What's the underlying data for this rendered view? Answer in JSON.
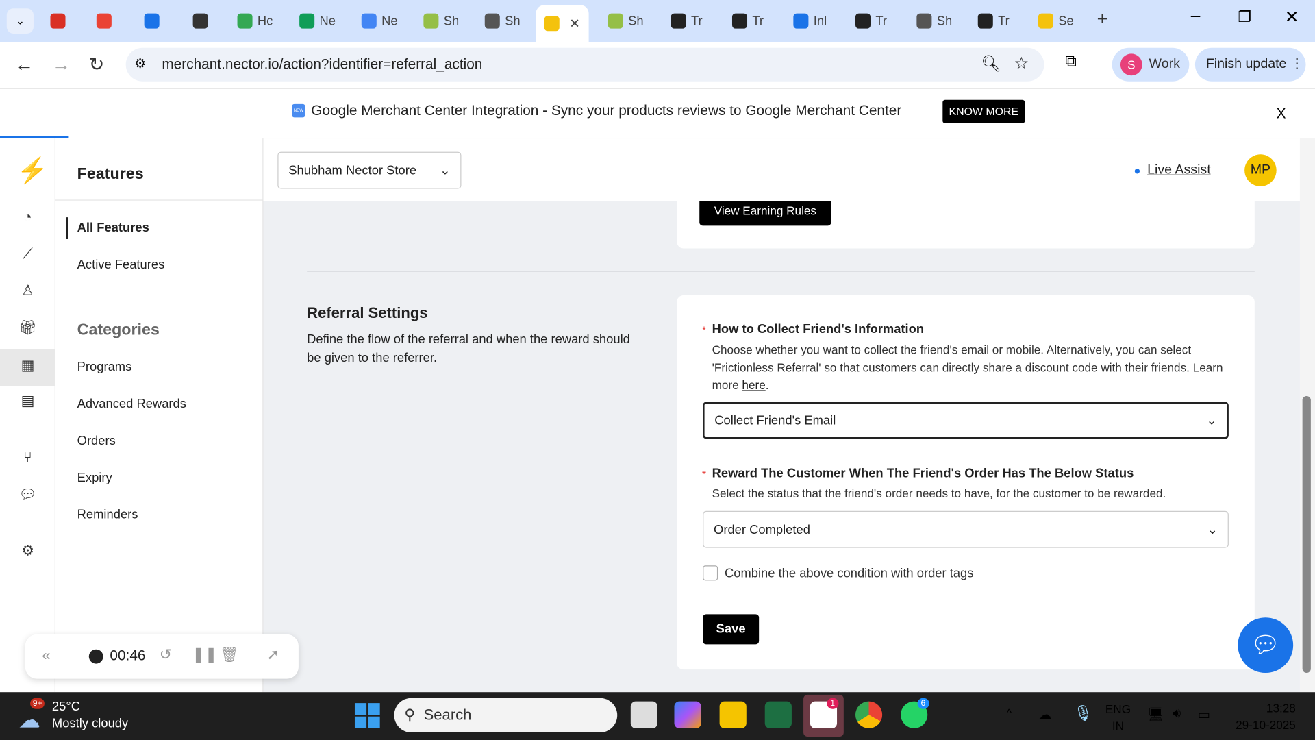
{
  "browser": {
    "tabs": [
      {
        "label": "",
        "color": "#d93025"
      },
      {
        "label": "",
        "color": "#ea4335"
      },
      {
        "label": "",
        "color": "#1a73e8"
      },
      {
        "label": "",
        "color": "#333"
      },
      {
        "label": "Hc",
        "color": "#34a853"
      },
      {
        "label": "Ne",
        "color": "#0f9d58"
      },
      {
        "label": "Ne",
        "color": "#4285f4"
      },
      {
        "label": "Sh",
        "color": "#95bf47"
      },
      {
        "label": "Sh",
        "color": "#555"
      },
      {
        "label": "",
        "color": "#f4c20d"
      },
      {
        "label": "Sh",
        "color": "#95bf47"
      },
      {
        "label": "Tr",
        "color": "#222"
      },
      {
        "label": "Tr",
        "color": "#222"
      },
      {
        "label": "Inl",
        "color": "#1a73e8"
      },
      {
        "label": "Tr",
        "color": "#222"
      },
      {
        "label": "Sh",
        "color": "#555"
      },
      {
        "label": "Tr",
        "color": "#222"
      },
      {
        "label": "Se",
        "color": "#f4c20d"
      }
    ],
    "url": "merchant.nector.io/action?identifier=referral_action",
    "profile_initial": "S",
    "profile_label": "Work",
    "update_label": "Finish update"
  },
  "banner": {
    "badge": "NEW",
    "text": "Google Merchant Center Integration - Sync your products reviews to Google Merchant Center",
    "button": "KNOW MORE",
    "close": "X"
  },
  "app": {
    "features_title": "Features",
    "nav": [
      "All Features",
      "Active Features"
    ],
    "categories_title": "Categories",
    "categories": [
      "Programs",
      "Advanced Rewards",
      "Orders",
      "Expiry",
      "Reminders"
    ],
    "store": "Shubham Nector Store",
    "live_assist": "Live Assist",
    "avatar": "MP",
    "view_rules": "View Earning Rules",
    "section_title": "Referral Settings",
    "section_desc": "Define the flow of the referral and when the reward should be given to the referrer.",
    "q1_title": "How to Collect Friend's Information",
    "q1_desc": "Choose whether you want to collect the friend's email or mobile. Alternatively, you can select 'Frictionless Referral' so that customers can directly share a discount code with their friends.",
    "q1_learn": "Learn more ",
    "q1_link": "here",
    "q1_value": "Collect Friend's Email",
    "q2_title": "Reward The Customer When The Friend's Order Has The Below Status",
    "q2_desc": "Select the status that the friend's order needs to have, for the customer to be rewarded.",
    "q2_value": "Order Completed",
    "checkbox_label": "Combine the above condition with order tags",
    "checkbox_checked": false,
    "save": "Save",
    "required_mark": "*"
  },
  "recorder": {
    "time": "00:46"
  },
  "taskbar": {
    "weather_badge": "9+",
    "temp": "25°C",
    "weather": "Mostly cloudy",
    "search": "Search",
    "slack_badge": "1",
    "whatsapp_badge": "6",
    "lang1": "ENG",
    "lang2": "IN",
    "time": "13:28",
    "date": "29-10-2025"
  },
  "colors": {
    "accent": "#1a73e8",
    "brand": "#f5c400",
    "required": "#e53935"
  }
}
